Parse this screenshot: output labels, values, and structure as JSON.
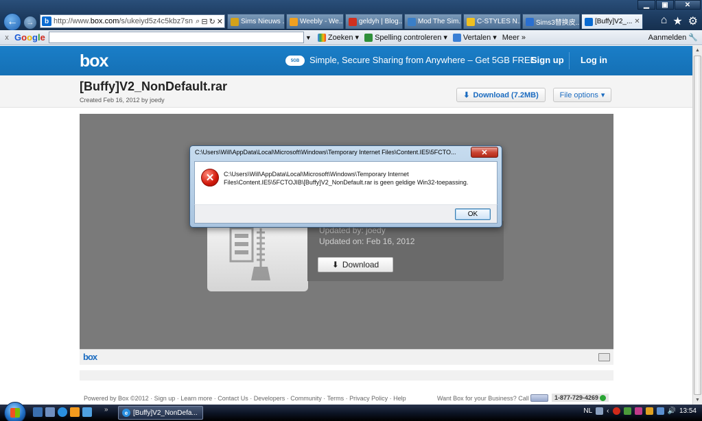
{
  "window": {
    "minimize": "▁",
    "maximize": "▣",
    "close": "✕"
  },
  "nav": {
    "back_icon": "arrow-left-icon",
    "forward_icon": "arrow-right-icon"
  },
  "address": {
    "url_prefix": "http://www.",
    "url_domain": "box.com",
    "url_rest": "/s/ukeiyd5z4c5kbz7sn",
    "search_glyph": "⌕",
    "compat_glyph": "⊟",
    "refresh_glyph": "↻",
    "stop_glyph": "✕"
  },
  "tabs": [
    {
      "label": "Sims Nieuws ...",
      "color": "#d3a21a",
      "active": false
    },
    {
      "label": "Weebly - We...",
      "color": "#f0a020",
      "active": false
    },
    {
      "label": "geldyh | Blog...",
      "color": "#d03020",
      "active": false
    },
    {
      "label": "Mod The Sim...",
      "color": "#3a7fc8",
      "active": false
    },
    {
      "label": "C-STYLES N...",
      "color": "#f0c020",
      "active": false
    },
    {
      "label": "Sims3替换皮...",
      "color": "#2a6fd0",
      "active": false
    },
    {
      "label": "[Buffy]V2_...",
      "color": "#0a6bd1",
      "active": true
    }
  ],
  "top_right": {
    "home_icon": "⌂",
    "favorites_icon": "★",
    "tools_icon": "⚙"
  },
  "google_toolbar": {
    "close": "x",
    "logo": [
      "G",
      "o",
      "o",
      "g",
      "l",
      "e"
    ],
    "search_label": "Zoeken",
    "spell_label": "Spelling controleren",
    "translate_label": "Vertalen",
    "more_label": "Meer »",
    "login_label": "Aanmelden"
  },
  "box": {
    "logo": "box",
    "promo_badge": "5GB",
    "promo_text": "Simple, Secure Sharing from Anywhere – Get 5GB FREE",
    "signup": "Sign up",
    "login": "Log in",
    "file_name": "[Buffy]V2_NonDefault.rar",
    "file_meta": "Created Feb 16, 2012 by joedy",
    "download_label": "Download  (7.2MB)",
    "file_options_label": "File options",
    "updated_by": "Updated by: joedy",
    "updated_on": "Updated on: Feb 16, 2012",
    "panel_download": "Download",
    "preview_logo": "box"
  },
  "footer": {
    "links": "Powered by Box ©2012  ·  Sign up  ·  Learn more  ·  Contact Us  ·  Developers  ·  Community  ·  Terms  ·  Privacy Policy  ·  Help",
    "business": "Want Box for your Business? Call",
    "phone": "1-877-729-4269"
  },
  "dialog": {
    "title": "C:\\Users\\Will\\AppData\\Local\\Microsoft\\Windows\\Temporary Internet Files\\Content.IE5\\5FCTO...",
    "message_line1": "C:\\Users\\Will\\AppData\\Local\\Microsoft\\Windows\\Temporary Internet",
    "message_line2": "Files\\Content.IE5\\5FCTOJIB\\[Buffy]V2_NonDefault.rar is geen geldige Win32-toepassing.",
    "ok": "OK",
    "close": "✕",
    "error_glyph": "✕"
  },
  "taskbar": {
    "more": "»",
    "task_label": "[Buffy]V2_NonDefa...",
    "lang": "NL",
    "clock": "13:54"
  }
}
